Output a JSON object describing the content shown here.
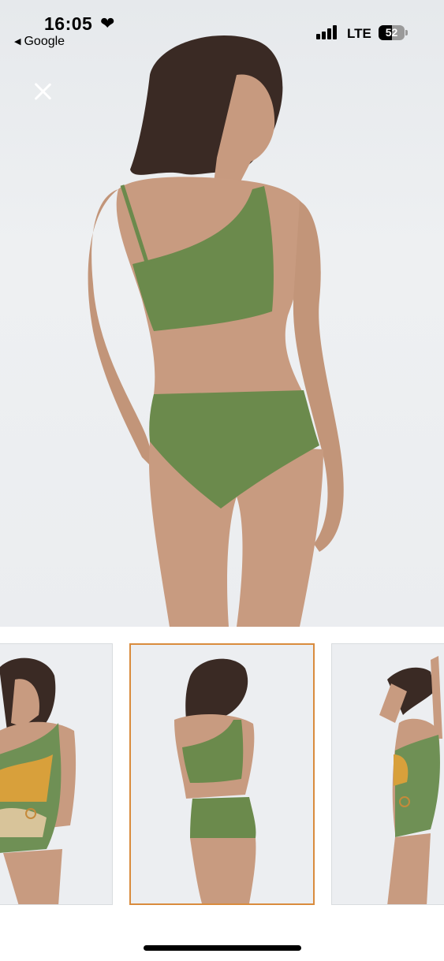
{
  "status_bar": {
    "time": "16:05",
    "heart_icon": "heart-icon",
    "back_app": "Google",
    "network": "LTE",
    "battery_level": "52",
    "battery_fraction": 0.52
  },
  "viewer": {
    "close_icon": "close-icon",
    "main_image": "swimsuit-model-back-view",
    "accent_color": "#d98b3d",
    "thumbnails": [
      {
        "name": "one-shoulder-colorblock-swimsuit-front",
        "selected": false
      },
      {
        "name": "green-bikini-back",
        "selected": true
      },
      {
        "name": "one-shoulder-colorblock-swimsuit-side",
        "selected": false
      }
    ]
  }
}
